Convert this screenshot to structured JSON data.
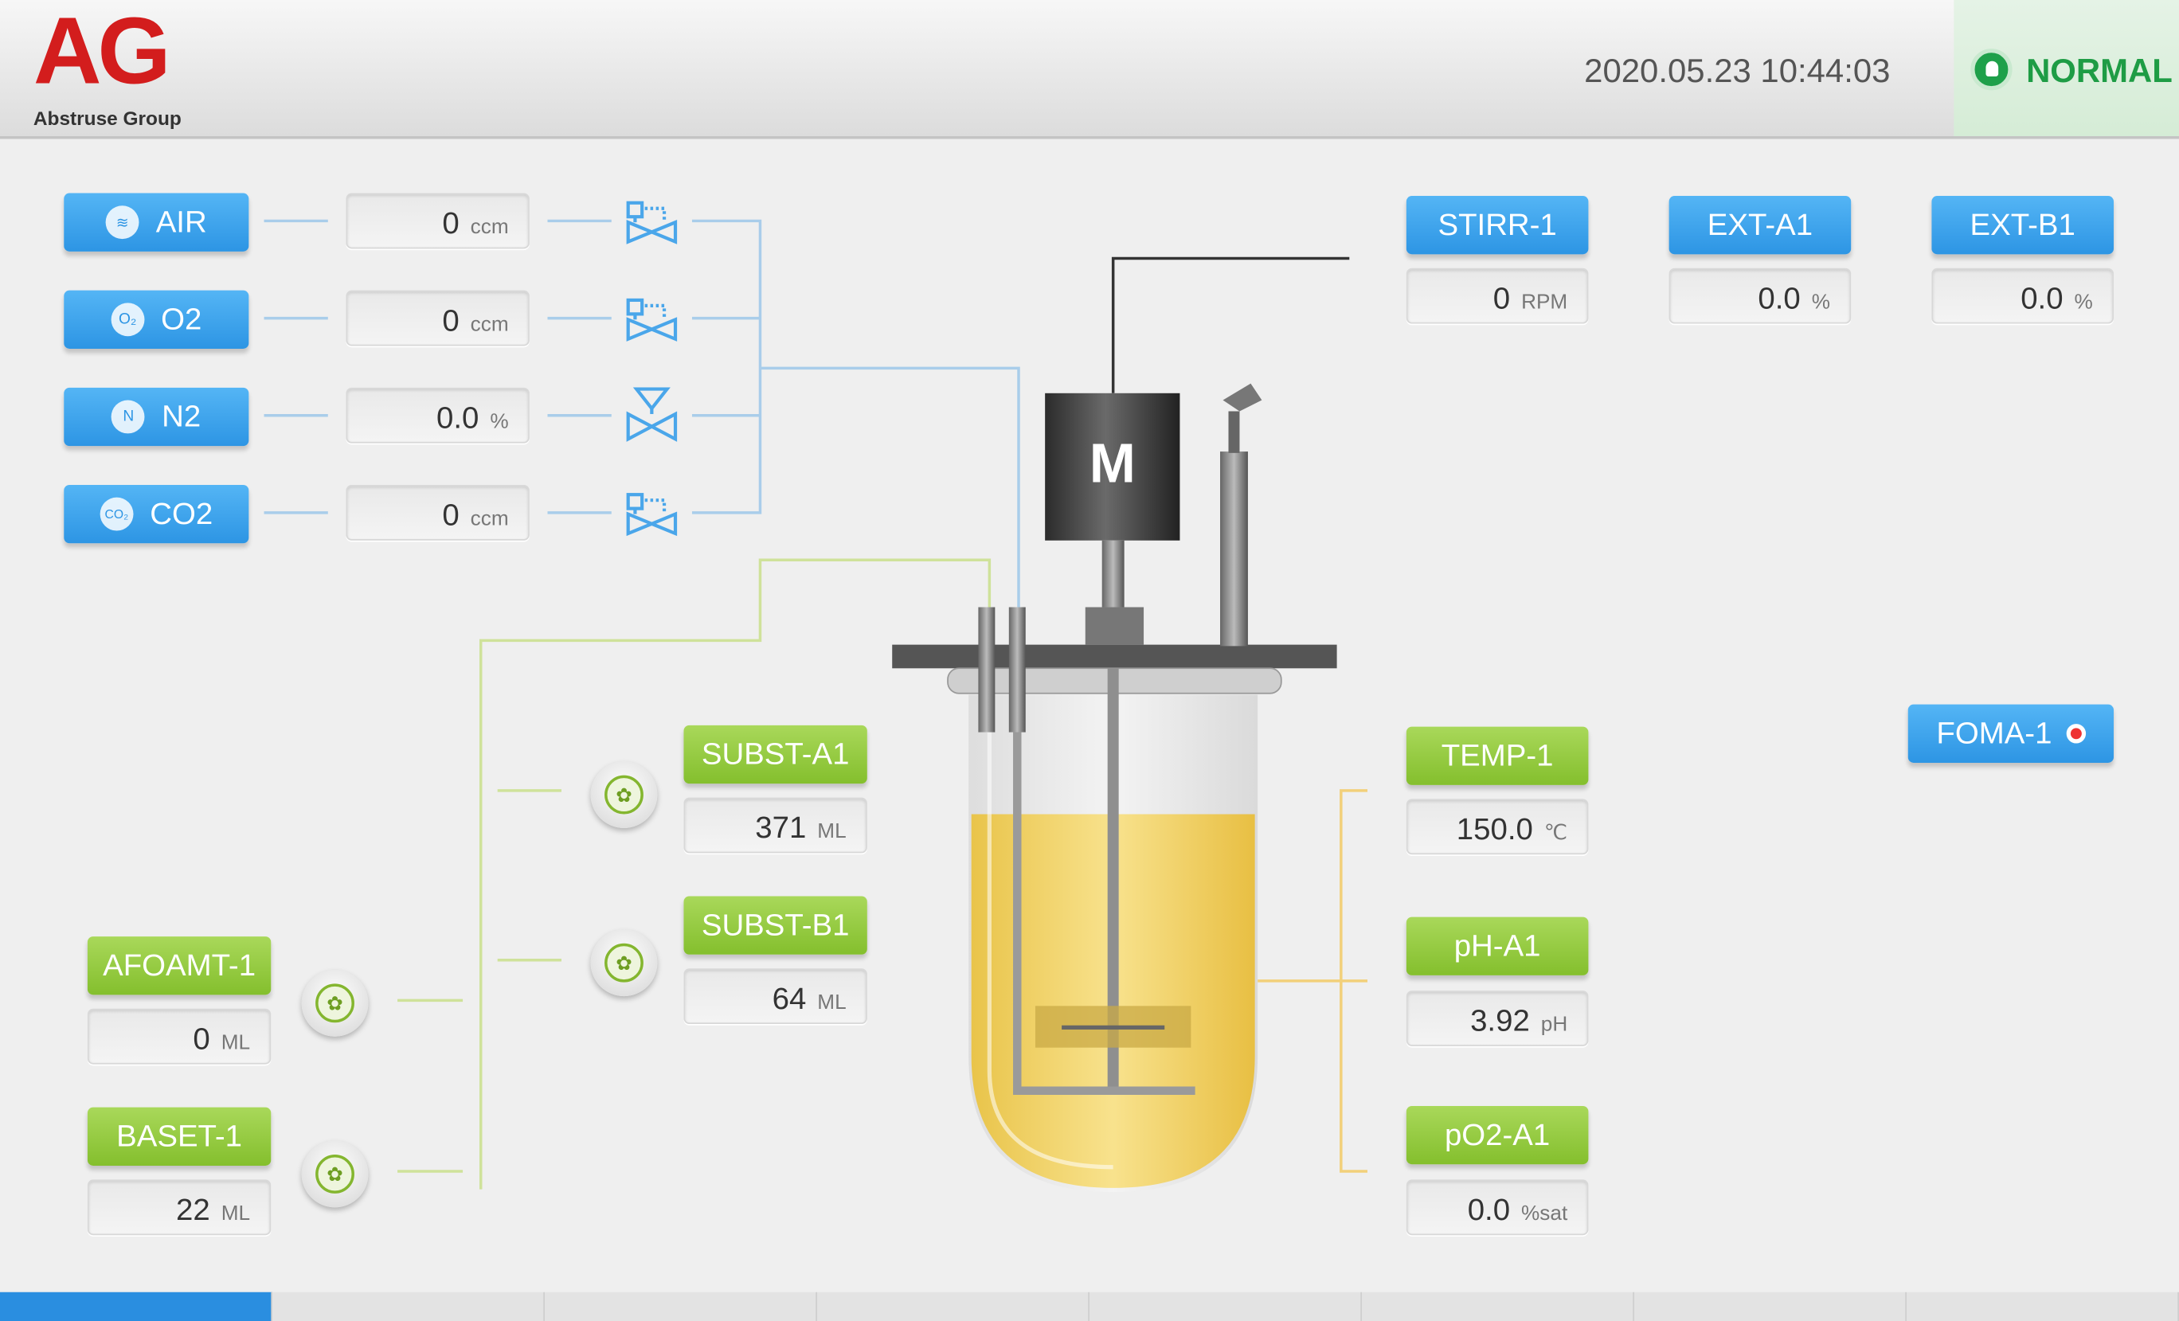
{
  "header": {
    "logo": "AG",
    "company": "Abstruse Group",
    "datetime": "2020.05.23  10:44:03",
    "status": "NORMAL"
  },
  "gases": [
    {
      "name": "AIR",
      "icon": "air-icon",
      "value": "0",
      "unit": "ccm"
    },
    {
      "name": "O2",
      "icon": "o2-icon",
      "value": "0",
      "unit": "ccm"
    },
    {
      "name": "N2",
      "icon": "n2-icon",
      "value": "0.0",
      "unit": "%"
    },
    {
      "name": "CO2",
      "icon": "co2-icon",
      "value": "0",
      "unit": "ccm"
    }
  ],
  "icon_glyphs": {
    "air": "≋",
    "o2": "O₂",
    "n2": "N",
    "co2": "CO₂",
    "pump": "✿"
  },
  "reactor": {
    "motor_label": "M"
  },
  "top_controls": [
    {
      "name": "STIRR-1",
      "value": "0",
      "unit": "RPM"
    },
    {
      "name": "EXT-A1",
      "value": "0.0",
      "unit": "%"
    },
    {
      "name": "EXT-B1",
      "value": "0.0",
      "unit": "%"
    }
  ],
  "foma": {
    "name": "FOMA-1"
  },
  "substrates": [
    {
      "name": "SUBST-A1",
      "value": "371",
      "unit": "ML"
    },
    {
      "name": "SUBST-B1",
      "value": "64",
      "unit": "ML"
    }
  ],
  "pumps_left": [
    {
      "name": "AFOAMT-1",
      "value": "0",
      "unit": "ML"
    },
    {
      "name": "BASET-1",
      "value": "22",
      "unit": "ML"
    }
  ],
  "sensors": [
    {
      "name": "TEMP-1",
      "value": "150.0",
      "unit": "℃"
    },
    {
      "name": "pH-A1",
      "value": "3.92",
      "unit": "pH"
    },
    {
      "name": "pO2-A1",
      "value": "0.0",
      "unit": "%sat"
    }
  ],
  "tabs": {
    "active_index": 0,
    "count": 8
  },
  "colors": {
    "blue": "#2d95e4",
    "green": "#84bf2d",
    "status_green": "#1e9c45",
    "liquid": "#f3d468",
    "alarm_red": "#e33333"
  }
}
